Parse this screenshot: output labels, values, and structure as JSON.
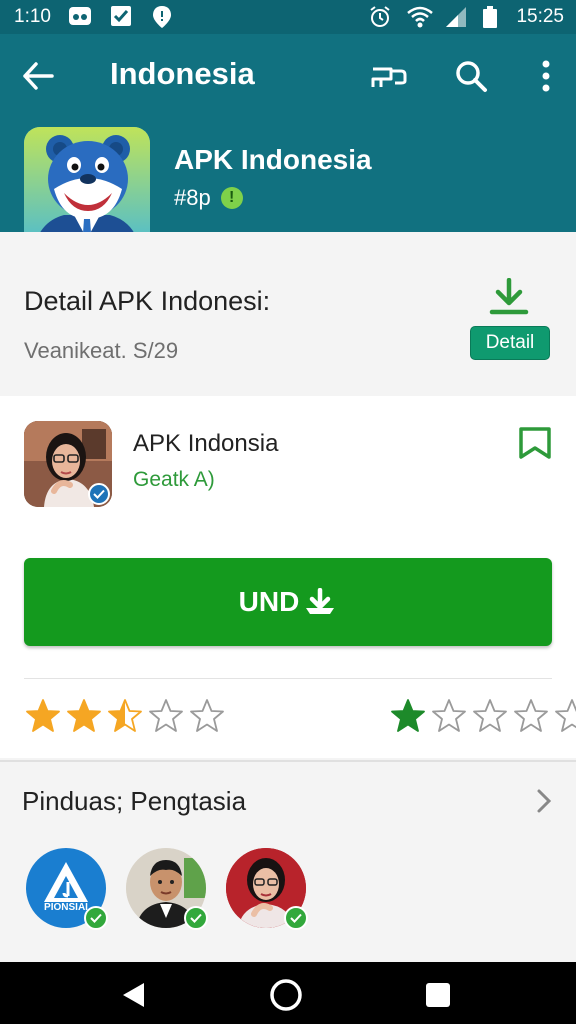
{
  "status_bar": {
    "time_left": "1:10",
    "time_right": "15:25",
    "icons_left": [
      "media-icon",
      "checkbox-icon",
      "location-icon"
    ],
    "icons_right": [
      "alarm-icon",
      "wifi-icon",
      "signal-icon",
      "battery-icon"
    ]
  },
  "app_bar": {
    "title": "Indonesia",
    "actions": [
      "back-arrow-icon",
      "share-icon",
      "search-icon",
      "more-vert-icon"
    ]
  },
  "header": {
    "app_name": "APK Indonesia",
    "subtitle": "#8p",
    "badge": "!"
  },
  "detail": {
    "title": "Detail APK Indonesi:",
    "subtitle": "Veanikeat. S/29",
    "button_label": "Detail"
  },
  "developer": {
    "name": "APK Indonsia",
    "subtitle": "Geatk A)"
  },
  "install": {
    "label": "UND"
  },
  "ratings": {
    "left_stars": 2.5,
    "right_stars": 1,
    "max": 5,
    "left_color": "#f5a623",
    "right_color": "#1d8a2a"
  },
  "similar": {
    "title": "Pinduas;  Pengtasia",
    "items": [
      {
        "label": "PIONSIAI"
      },
      {
        "label": ""
      },
      {
        "label": ""
      }
    ]
  },
  "colors": {
    "appbar": "#117180",
    "install_button": "#149a1e",
    "detail_button": "#0f9a6f"
  }
}
